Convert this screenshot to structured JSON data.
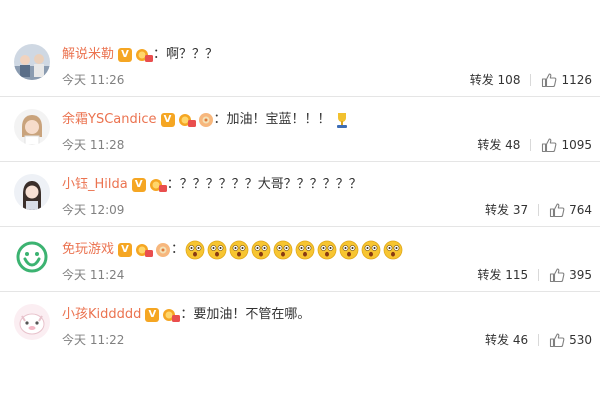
{
  "comments": [
    {
      "username": "解说米勒",
      "text": "：啊？？？",
      "time": "今天 11:26",
      "repost_label": "转发",
      "repost_count": "108",
      "like_count": "1126",
      "flower_badge": false,
      "emoji_count": 0,
      "trailing_icon": null
    },
    {
      "username": "余霜YSCandice",
      "text": "：加油！宝蓝！！！",
      "time": "今天 11:28",
      "repost_label": "转发",
      "repost_count": "48",
      "like_count": "1095",
      "flower_badge": true,
      "emoji_count": 0,
      "trailing_icon": "trophy-icon"
    },
    {
      "username": "小钰_Hilda",
      "text": "：？？？？？？大哥？？？？？？",
      "time": "今天 12:09",
      "repost_label": "转发",
      "repost_count": "37",
      "like_count": "764",
      "flower_badge": false,
      "emoji_count": 0,
      "trailing_icon": null
    },
    {
      "username": "免玩游戏",
      "text": "：",
      "time": "今天 11:24",
      "repost_label": "转发",
      "repost_count": "115",
      "like_count": "395",
      "flower_badge": true,
      "emoji_count": 10,
      "trailing_icon": null
    },
    {
      "username": "小孩Kiddddd",
      "text": "：要加油！不管在哪。",
      "time": "今天 11:22",
      "repost_label": "转发",
      "repost_count": "46",
      "like_count": "530",
      "flower_badge": false,
      "emoji_count": 0,
      "trailing_icon": null
    }
  ],
  "verified_badge": "V",
  "icons": {
    "like": "thumbs-up-icon",
    "verified": "verified-v-icon",
    "medal": "vip-medal-icon",
    "flower": "flower-badge-icon",
    "emoji": "shocked-face-icon"
  },
  "colors": {
    "username": "#eb7350",
    "text": "#333333",
    "time": "#808080",
    "verified": "#f5a623"
  }
}
